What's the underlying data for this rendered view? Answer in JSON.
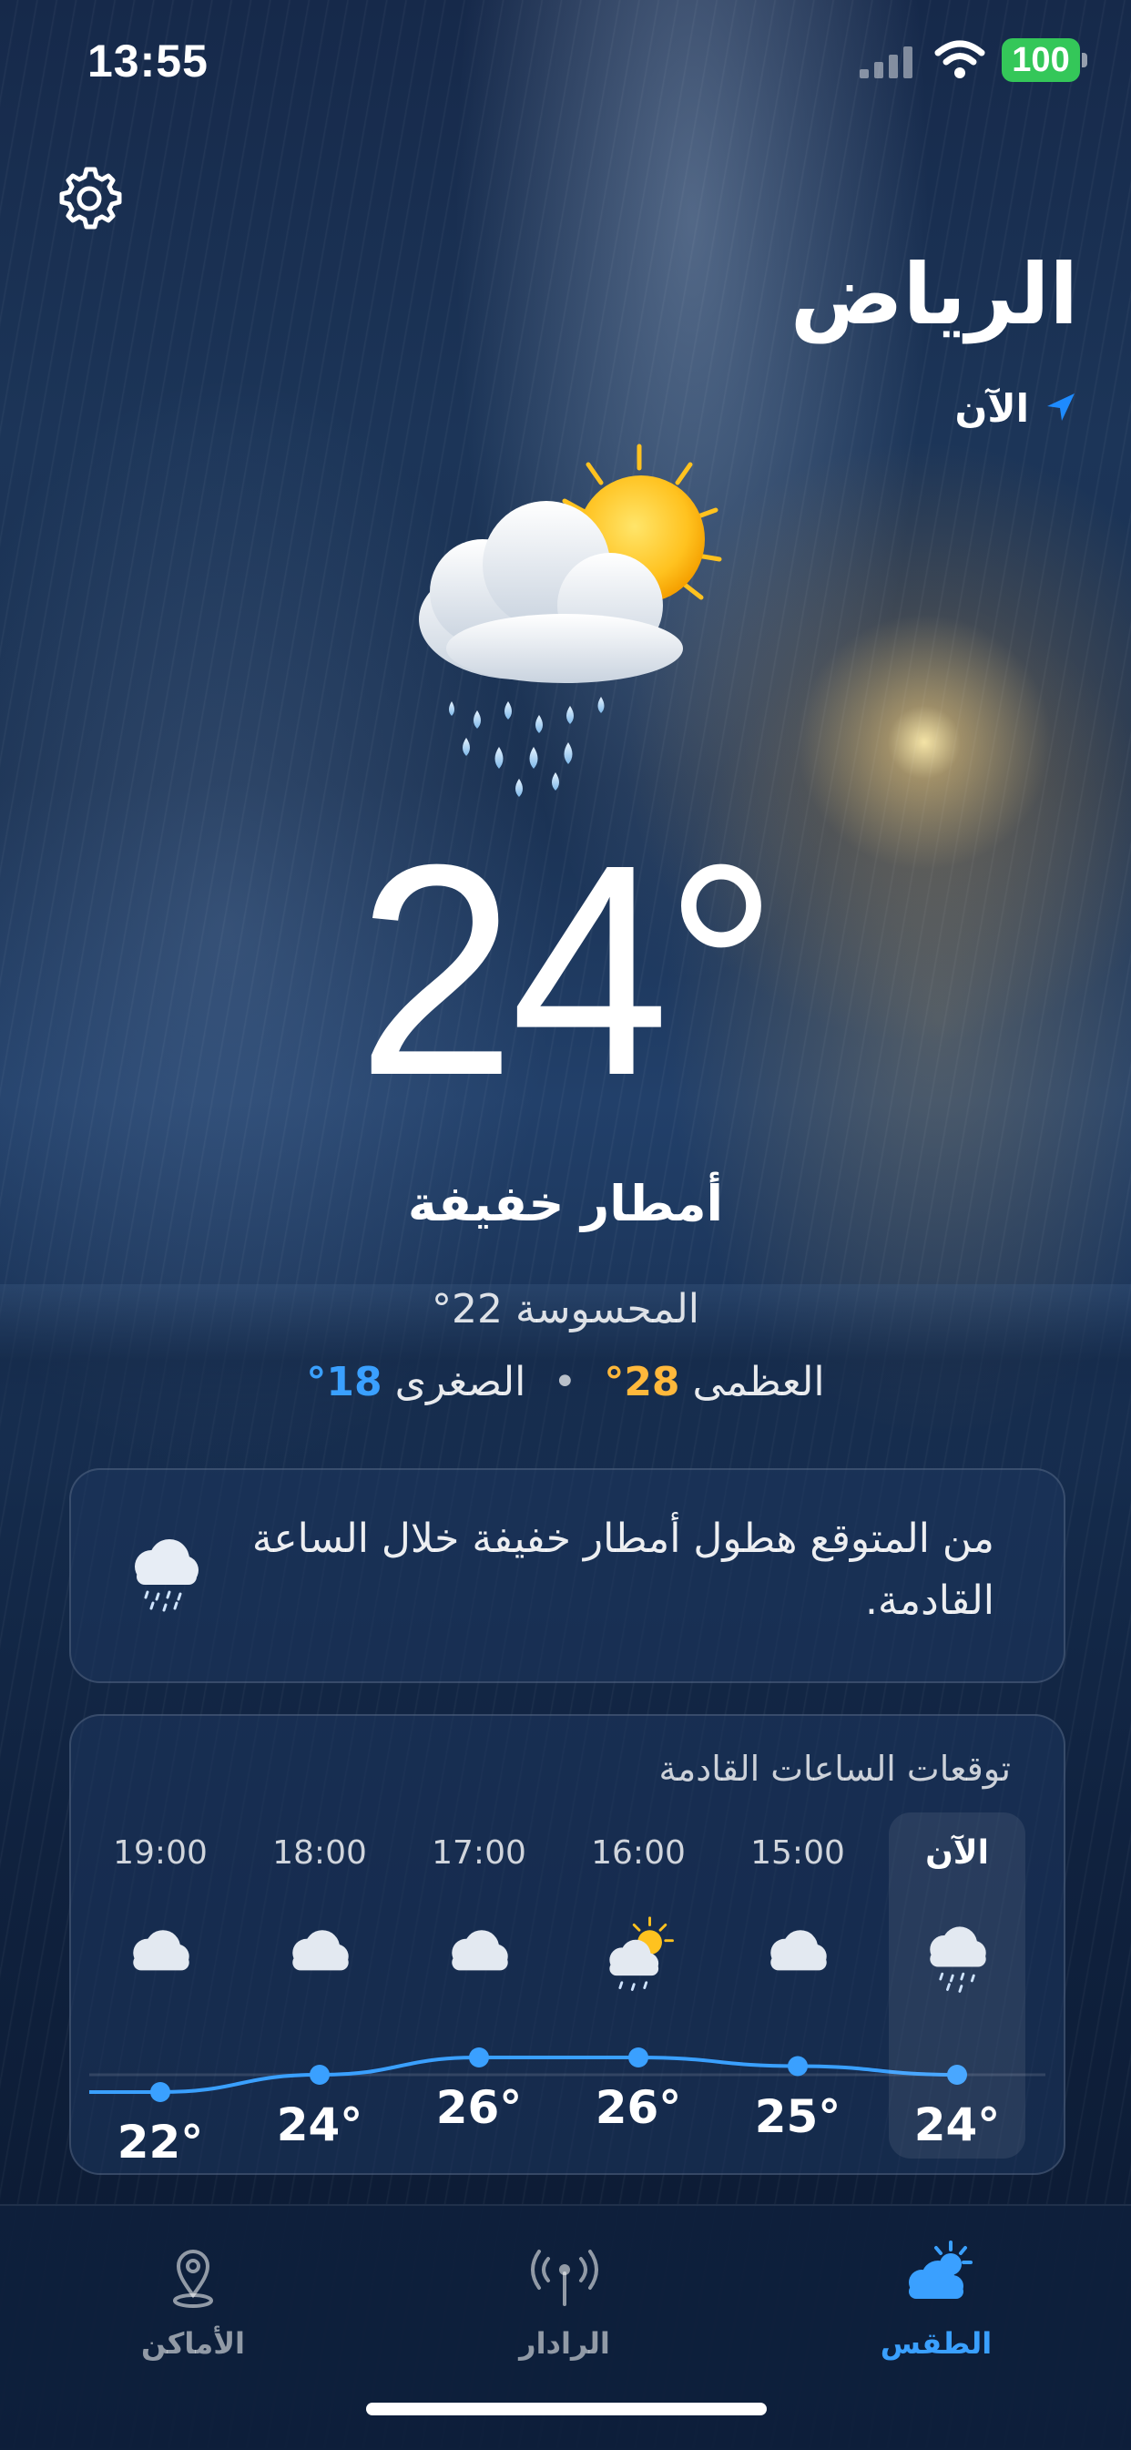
{
  "status_bar": {
    "time": "13:55",
    "battery": "100"
  },
  "header": {
    "city": "الرياض",
    "now_label": "الآن"
  },
  "current": {
    "temperature": "24°",
    "condition": "أمطار خفيفة",
    "feels_like": "المحسوسة 22°",
    "high_label": "العظمى",
    "high": "28°",
    "low_label": "الصغرى",
    "low": "18°",
    "separator": "•"
  },
  "alert": {
    "text": "من المتوقع هطول أمطار خفيفة خلال الساعة القادمة.",
    "icon": "rain-cloud-icon"
  },
  "hourly": {
    "title": "توقعات الساعات القادمة",
    "hours": [
      {
        "label": "الآن",
        "temp": "24°",
        "value": 24,
        "icon": "rain-cloud-icon"
      },
      {
        "label": "15:00",
        "temp": "25°",
        "value": 25,
        "icon": "cloud-icon"
      },
      {
        "label": "16:00",
        "temp": "26°",
        "value": 26,
        "icon": "partly-sunny-rain-icon"
      },
      {
        "label": "17:00",
        "temp": "26°",
        "value": 26,
        "icon": "cloud-icon"
      },
      {
        "label": "18:00",
        "temp": "24°",
        "value": 24,
        "icon": "cloud-icon"
      },
      {
        "label": "19:00",
        "temp": "22°",
        "value": 22,
        "icon": "cloud-icon"
      }
    ]
  },
  "tabs": [
    {
      "label": "الطقس",
      "icon": "weather-icon",
      "active": true
    },
    {
      "label": "الرادار",
      "icon": "radar-icon",
      "active": false
    },
    {
      "label": "الأماكن",
      "icon": "location-pin-icon",
      "active": false
    }
  ],
  "colors": {
    "accent": "#3aa0ff",
    "high": "#ffb83b",
    "battery": "#34c759"
  }
}
